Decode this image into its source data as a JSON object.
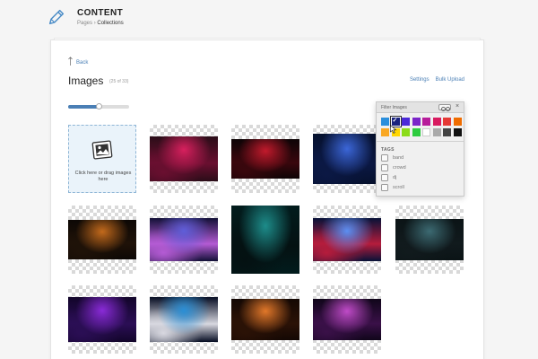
{
  "header": {
    "title": "CONTENT",
    "breadcrumb": [
      "Pages",
      "Collections"
    ]
  },
  "page": {
    "back_label": "Back",
    "title": "Images",
    "count": "(25 of 33)",
    "settings_label": "Settings",
    "bulk_upload_label": "Bulk Upload"
  },
  "slider": {
    "value_percent": 50
  },
  "upload": {
    "text": "Click here or drag images here"
  },
  "filter": {
    "title": "Filter Images",
    "close": "×",
    "colors": [
      "#2b8fdc",
      "#1a237e",
      "#4b2ad8",
      "#7b25c9",
      "#b71c9a",
      "#d81b60",
      "#e53935",
      "#ef6c00",
      "#f9a825",
      "#ffd600",
      "#8bdc1a",
      "#2ecc40",
      "#ffffff",
      "#aaaaaa",
      "#444444",
      "#111111"
    ],
    "selected_index": 1,
    "tags_heading": "TAGS",
    "tags": [
      "band",
      "crowd",
      "dj",
      "scroll"
    ]
  },
  "images": [
    {
      "name": "image-concert-pink-crowd",
      "colors": [
        "#2a0d18",
        "#d8205e",
        "#6a0f30"
      ],
      "h": 50
    },
    {
      "name": "image-stage-red-lights",
      "colors": [
        "#0d0406",
        "#c21a2c",
        "#3a070d"
      ],
      "h": 44
    },
    {
      "name": "image-guitarists-blue-stage",
      "colors": [
        "#06112e",
        "#3b66d8",
        "#0b1844"
      ],
      "h": 56
    },
    {
      "name": "image-band-sepia",
      "colors": [
        "#4e3520",
        "#9b7a58",
        "#2a1b0f"
      ],
      "h": 50
    },
    {
      "name": "image-stage-orange-lights",
      "colors": [
        "#0d0805",
        "#c36a1c",
        "#1f1208"
      ],
      "h": 44
    },
    {
      "name": "image-drummer-blue-purple",
      "colors": [
        "#121036",
        "#5f5ed9",
        "#b45bd4"
      ],
      "h": 48
    },
    {
      "name": "image-singer-teal-spotlight",
      "colors": [
        "#021c1d",
        "#1d8c8a",
        "#041112"
      ],
      "h": 76
    },
    {
      "name": "image-singer-blue-rays",
      "colors": [
        "#071238",
        "#5c8ff2",
        "#b51c3c"
      ],
      "h": 48
    },
    {
      "name": "image-band-dark-stage",
      "colors": [
        "#0b1416",
        "#3c6a72",
        "#111a1d"
      ],
      "h": 46
    },
    {
      "name": "image-dj-purple-mixer",
      "colors": [
        "#12052a",
        "#8a2bd8",
        "#2b0e55"
      ],
      "h": 50
    },
    {
      "name": "image-crowd-cyan-lights",
      "colors": [
        "#050c22",
        "#2a8fd6",
        "#d8d8e0"
      ],
      "h": 50
    },
    {
      "name": "image-stage-orange-crowd",
      "colors": [
        "#140804",
        "#e2782a",
        "#2b1206"
      ],
      "h": 46
    },
    {
      "name": "image-stage-magenta-haze",
      "colors": [
        "#10061a",
        "#c04bc8",
        "#3a1048"
      ],
      "h": 46
    }
  ]
}
